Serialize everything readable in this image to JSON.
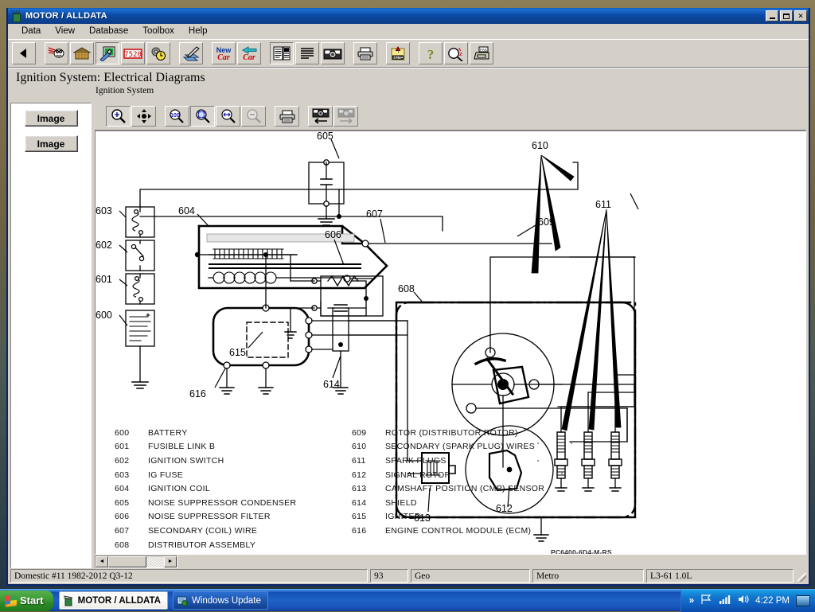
{
  "window": {
    "title": "MOTOR / ALLDATA",
    "app_icon": "motor-alldata-icon",
    "minimize_label": "Minimize",
    "maximize_label": "Maximize",
    "close_label": "Close",
    "close_glyph": "✕"
  },
  "menu": {
    "items": [
      {
        "label": "Data"
      },
      {
        "label": "View"
      },
      {
        "label": "Database"
      },
      {
        "label": "Toolbox"
      },
      {
        "label": "Help"
      }
    ]
  },
  "toolbar": {
    "buttons": [
      {
        "name": "back-button",
        "icon": "left-triangle-icon",
        "pressed": false
      },
      {
        "name": "comet-button",
        "icon": "comet-icon",
        "pressed": false
      },
      {
        "name": "home-button",
        "icon": "home-icon",
        "pressed": false
      },
      {
        "name": "diagrams-button",
        "icon": "wrench-chart-icon",
        "pressed": true
      },
      {
        "name": "odometer-button",
        "icon": "odometer-7520-icon",
        "pressed": false
      },
      {
        "name": "timer-button",
        "icon": "gear-clock-icon",
        "pressed": false
      },
      {
        "name": "pen-button",
        "icon": "pen-notes-icon",
        "pressed": false
      },
      {
        "name": "new-car-button",
        "icon": "new-car-icon",
        "pressed": false
      },
      {
        "name": "previous-car-button",
        "icon": "back-car-icon",
        "pressed": false
      },
      {
        "name": "specs-list-button",
        "icon": "list-table-icon",
        "pressed": true
      },
      {
        "name": "text-lines-button",
        "icon": "text-lines-icon",
        "pressed": false
      },
      {
        "name": "camera-button",
        "icon": "camera-icon",
        "pressed": false
      },
      {
        "name": "print-button",
        "icon": "printer-icon",
        "pressed": false
      },
      {
        "name": "note-button",
        "icon": "note-pin-icon",
        "pressed": false
      },
      {
        "name": "help-button",
        "icon": "question-mark-icon",
        "pressed": false
      },
      {
        "name": "find-button",
        "icon": "magnifier-az-icon",
        "pressed": false
      },
      {
        "name": "fax-button",
        "icon": "fax-icon",
        "pressed": false
      }
    ]
  },
  "heading": {
    "title": "Ignition System:  Electrical Diagrams",
    "subtitle": "Ignition System"
  },
  "left_pane": {
    "buttons": [
      {
        "label": "Image",
        "name": "image-button-1"
      },
      {
        "label": "Image",
        "name": "image-button-2"
      }
    ]
  },
  "view_toolbar": {
    "buttons": [
      {
        "name": "zoom-in-button",
        "icon": "magnifier-plus-icon",
        "pressed": true
      },
      {
        "name": "pan-button",
        "icon": "four-arrows-icon",
        "pressed": false
      },
      {
        "name": "zoom-100-button",
        "icon": "magnifier-100-percent-icon",
        "pressed": false
      },
      {
        "name": "fit-page-button",
        "icon": "magnifier-fit-icon",
        "pressed": true
      },
      {
        "name": "fit-width-button",
        "icon": "magnifier-width-icon",
        "pressed": false
      },
      {
        "name": "zoom-out-button",
        "icon": "magnifier-minus-icon",
        "pressed": false
      },
      {
        "name": "print-image-button",
        "icon": "printer-icon",
        "pressed": false
      },
      {
        "name": "previous-image-button",
        "icon": "camera-left-arrow-icon",
        "pressed": false
      },
      {
        "name": "next-image-button",
        "icon": "camera-right-arrow-icon",
        "pressed": false
      }
    ]
  },
  "diagram": {
    "part_number": "PC6400-6D4-M-RS",
    "callouts": [
      "600",
      "601",
      "602",
      "603",
      "604",
      "605",
      "606",
      "607",
      "608",
      "609",
      "610",
      "611",
      "612",
      "613",
      "614",
      "615",
      "616"
    ],
    "legend_left": [
      {
        "num": "600",
        "text": "BATTERY"
      },
      {
        "num": "601",
        "text": "FUSIBLE LINK B"
      },
      {
        "num": "602",
        "text": "IGNITION SWITCH"
      },
      {
        "num": "603",
        "text": "IG FUSE"
      },
      {
        "num": "604",
        "text": "IGNITION COIL"
      },
      {
        "num": "605",
        "text": "NOISE SUPPRESSOR CONDENSER"
      },
      {
        "num": "606",
        "text": "NOISE SUPPRESSOR FILTER"
      },
      {
        "num": "607",
        "text": "SECONDARY (COIL) WIRE"
      },
      {
        "num": "608",
        "text": "DISTRIBUTOR ASSEMBLY"
      }
    ],
    "legend_right": [
      {
        "num": "609",
        "text": "ROTOR (DISTRIBUTOR ROTOR)"
      },
      {
        "num": "610",
        "text": "SECONDARY (SPARK PLUG) WIRES"
      },
      {
        "num": "611",
        "text": "SPARK PLUGS"
      },
      {
        "num": "612",
        "text": "SIGNAL ROTOR"
      },
      {
        "num": "613",
        "text": "CAMSHAFT POSITION (CMP) SENSOR"
      },
      {
        "num": "614",
        "text": "SHIELD"
      },
      {
        "num": "615",
        "text": "IGNITER"
      },
      {
        "num": "616",
        "text": "ENGINE CONTROL MODULE (ECM)"
      }
    ]
  },
  "scrollbar": {
    "left_arrow": "◄",
    "right_arrow": "►"
  },
  "statusbar": {
    "database": "Domestic #11 1982-2012 Q3-12",
    "year": "93",
    "make": "Geo",
    "model": "Metro",
    "engine": "L3-61 1.0L"
  },
  "taskbar": {
    "start_label": "Start",
    "tasks": [
      {
        "label": "MOTOR / ALLDATA",
        "active": true,
        "icon": "motor-alldata-icon"
      },
      {
        "label": "Windows Update",
        "active": false,
        "icon": "windows-update-icon"
      }
    ],
    "tray": {
      "chevron": "»",
      "icons": [
        "show-hidden-icons",
        "flag-icon",
        "network-signal-icon",
        "volume-icon"
      ],
      "clock": "4:22 PM",
      "desktop_icon": "show-desktop-icon"
    }
  }
}
